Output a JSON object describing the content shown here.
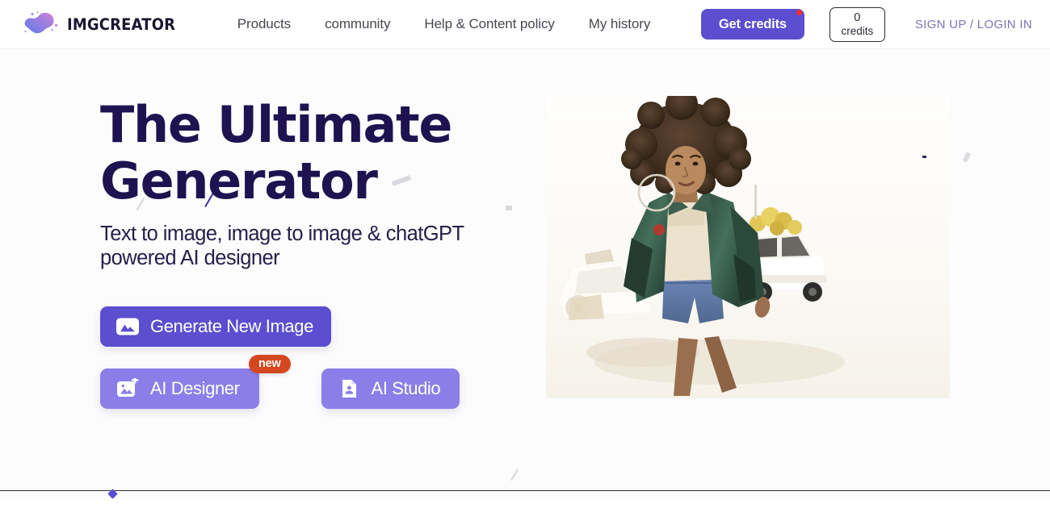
{
  "brand": {
    "name": "IMGCREATOR",
    "logo_icon": "blob-splatter-logo",
    "gradient_from": "#6a7ee8",
    "gradient_to": "#c07fd8"
  },
  "nav": {
    "links": [
      {
        "label": "Products",
        "name": "nav-link-products"
      },
      {
        "label": "community",
        "name": "nav-link-community"
      },
      {
        "label": "Help & Content policy",
        "name": "nav-link-help-content-policy"
      },
      {
        "label": "My history",
        "name": "nav-link-my-history"
      }
    ],
    "get_credits": {
      "label": "Get credits",
      "color": "#5b4ecf",
      "notification_dot_color": "#ff2f2f"
    },
    "credits": {
      "count": "0",
      "label": "credits"
    },
    "auth": {
      "label": "SIGN UP / LOGIN IN",
      "color": "#7b74b8"
    }
  },
  "hero": {
    "headline_line1": "The Ultimate",
    "headline_line2": "Generator",
    "headline_color": "#1e1350",
    "subhead": "Text to image, image to image & chatGPT powered AI designer",
    "buttons": {
      "generate": {
        "label": "Generate New Image",
        "icon": "image-mountain-icon",
        "color": "#5b4ecf"
      },
      "designer": {
        "label": "AI Designer",
        "icon": "image-plus-icon",
        "color": "#8b7ee8",
        "badge": "new",
        "badge_color": "#d4481f"
      },
      "studio": {
        "label": "AI Studio",
        "icon": "document-person-icon",
        "color": "#8b7ee8"
      }
    },
    "image_alt": "Woman with curly afro hair wearing a green oversized jacket and denim shorts walking in front of a white vehicle"
  },
  "decor": {
    "diamond_color": "#5b4ecf",
    "dash_color": "#d8d8dd"
  }
}
